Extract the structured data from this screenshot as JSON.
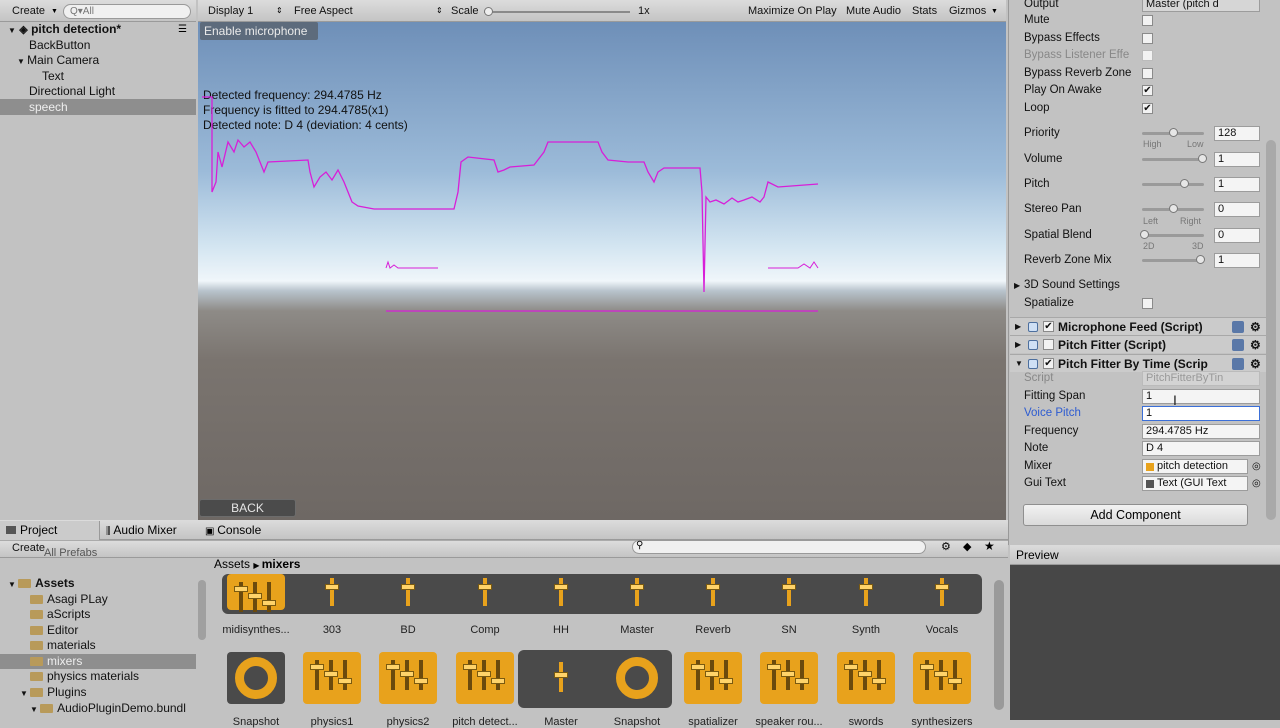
{
  "hierarchy": {
    "create_label": "Create",
    "search_placeholder": "Q▾All",
    "scene": "pitch detection*",
    "items": [
      "BackButton",
      "Main Camera",
      "Text",
      "Directional Light",
      "speech"
    ]
  },
  "game_toolbar": {
    "display": "Display 1",
    "aspect": "Free Aspect",
    "scale_label": "Scale",
    "scale_value": "1x",
    "maximize": "Maximize On Play",
    "mute": "Mute Audio",
    "stats": "Stats",
    "gizmos": "Gizmos"
  },
  "game_view": {
    "mic_button": "Enable microphone",
    "line1": "Detected frequency: 294.4785 Hz",
    "line2": "Frequency is fitted to 294.4785(x1)",
    "line3": "Detected note: D 4 (deviation: 4 cents)",
    "back_button": "BACK",
    "graph_color": "#d81ed8"
  },
  "inspector": {
    "output_label": "Output",
    "output_value": "Master (pitch d",
    "mute": "Mute",
    "bypass_effects": "Bypass Effects",
    "bypass_listener": "Bypass Listener Effe",
    "bypass_reverb": "Bypass Reverb Zone",
    "play_on_awake": "Play On Awake",
    "loop": "Loop",
    "priority": {
      "label": "Priority",
      "value": "128",
      "high": "High",
      "low": "Low"
    },
    "volume": {
      "label": "Volume",
      "value": "1"
    },
    "pitch": {
      "label": "Pitch",
      "value": "1"
    },
    "stereo_pan": {
      "label": "Stereo Pan",
      "value": "0",
      "left": "Left",
      "right": "Right"
    },
    "spatial_blend": {
      "label": "Spatial Blend",
      "value": "0",
      "d2": "2D",
      "d3": "3D"
    },
    "reverb_mix": {
      "label": "Reverb Zone Mix",
      "value": "1"
    },
    "sound_settings": "3D Sound Settings",
    "spatialize": "Spatialize",
    "comp_mic": "Microphone Feed (Script)",
    "comp_fitter": "Pitch Fitter (Script)",
    "comp_fitter_time": "Pitch Fitter By Time (Scrip",
    "script": {
      "label": "Script",
      "value": "PitchFitterByTin"
    },
    "fitting_span": {
      "label": "Fitting Span",
      "value": "1"
    },
    "voice_pitch": {
      "label": "Voice Pitch",
      "value": "1"
    },
    "frequency": {
      "label": "Frequency",
      "value": "294.4785 Hz"
    },
    "note": {
      "label": "Note",
      "value": "D 4"
    },
    "mixer": {
      "label": "Mixer",
      "value": "pitch detection"
    },
    "gui_text": {
      "label": "Gui Text",
      "value": "Text (GUI Text"
    },
    "add_component": "Add Component",
    "preview": "Preview"
  },
  "project": {
    "tabs": [
      "Project",
      "Audio Mixer",
      "Console"
    ],
    "create_label": "Create",
    "folders": [
      "All Prefabs",
      "Assets",
      "Asagi PLay",
      "aScripts",
      "Editor",
      "materials",
      "mixers",
      "physics materials",
      "Plugins",
      "AudioPluginDemo.bundl"
    ],
    "breadcrumb": [
      "Assets",
      "mixers"
    ],
    "row1": [
      "midisynthes...",
      "303",
      "BD",
      "Comp",
      "HH",
      "Master",
      "Reverb",
      "SN",
      "Synth",
      "Vocals"
    ],
    "row2": [
      "Snapshot",
      "physics1",
      "physics2",
      "pitch detect...",
      "Master",
      "Snapshot",
      "spatializer",
      "speaker rou...",
      "swords",
      "synthesizers"
    ]
  }
}
